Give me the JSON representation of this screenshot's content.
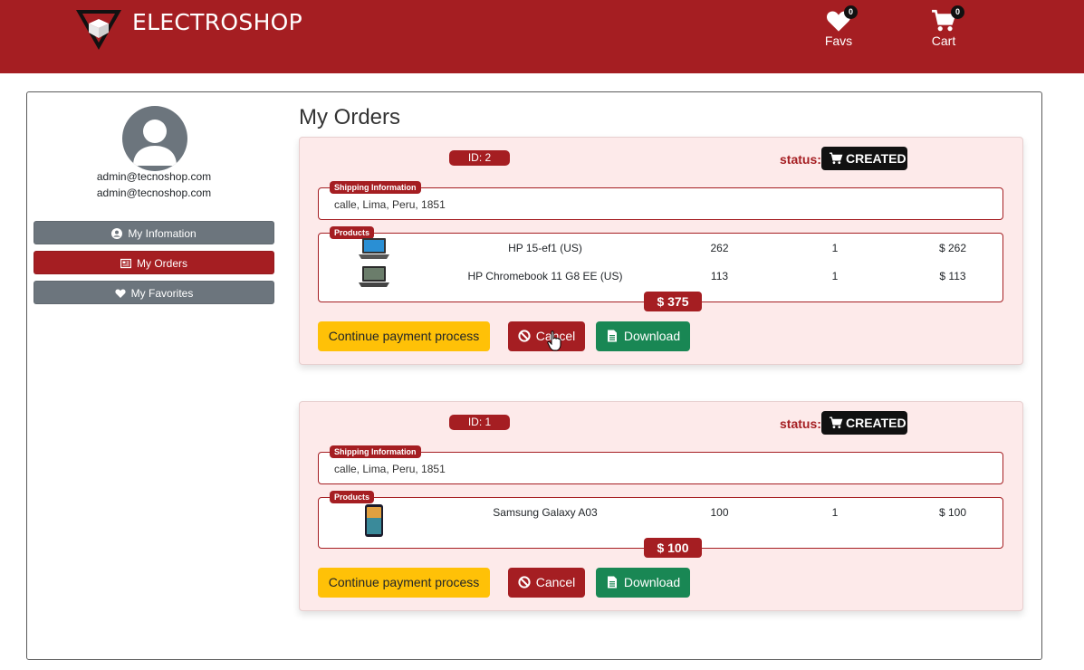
{
  "header": {
    "brand": "ELECTROSHOP",
    "favs": {
      "label": "Favs",
      "count": "0"
    },
    "cart": {
      "label": "Cart",
      "count": "0"
    },
    "accent_color": "#a51e22"
  },
  "sidebar": {
    "email_line1": "admin@tecnoshop.com",
    "email_line2": "admin@tecnoshop.com",
    "items": [
      {
        "label": "My Infomation",
        "icon": "user-circle-icon",
        "active": false
      },
      {
        "label": "My Orders",
        "icon": "orders-list-icon",
        "active": true
      },
      {
        "label": "My Favorites",
        "icon": "heart-icon",
        "active": false
      }
    ]
  },
  "main": {
    "title": "My Orders",
    "status_label": "status:",
    "shipping_tag": "Shipping Information",
    "products_tag": "Products",
    "buttons": {
      "pay": "Continue payment process",
      "cancel": "Cancel",
      "download": "Download"
    },
    "orders": [
      {
        "id_label": "ID: 2",
        "status": "CREATED",
        "shipping": "calle, Lima, Peru, 1851",
        "products": [
          {
            "name": "HP 15-ef1 (US)",
            "price": "262",
            "qty": "1",
            "total": "$ 262",
            "icon": "laptop-icon"
          },
          {
            "name": "HP Chromebook 11 G8 EE (US)",
            "price": "113",
            "qty": "1",
            "total": "$ 113",
            "icon": "chromebook-icon"
          }
        ],
        "total": "$ 375"
      },
      {
        "id_label": "ID: 1",
        "status": "CREATED",
        "shipping": "calle, Lima, Peru, 1851",
        "products": [
          {
            "name": "Samsung Galaxy A03",
            "price": "100",
            "qty": "1",
            "total": "$ 100",
            "icon": "phone-icon"
          }
        ],
        "total": "$ 100"
      }
    ]
  }
}
